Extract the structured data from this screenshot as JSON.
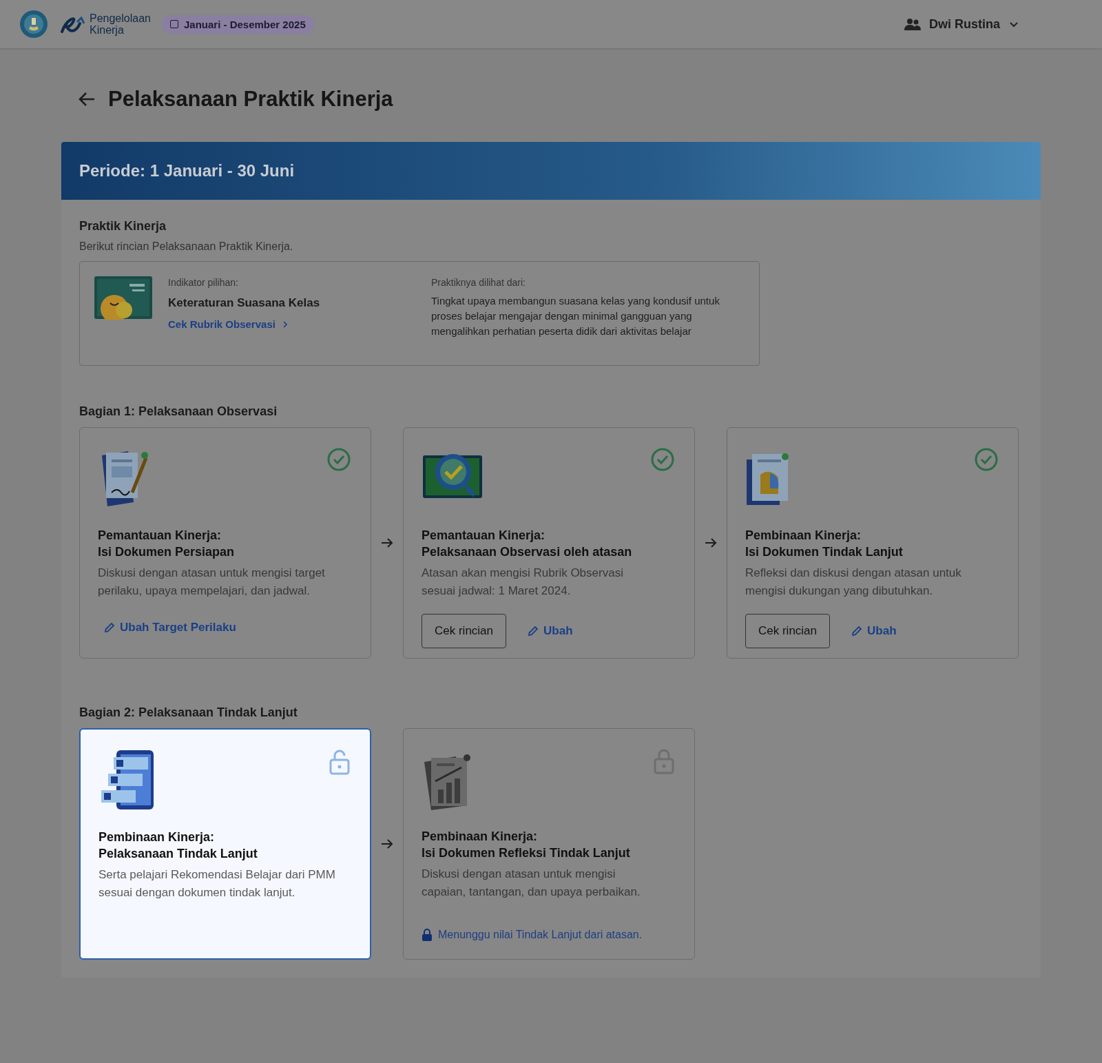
{
  "header": {
    "logo_text": [
      "Pengelolaan",
      "Kinerja"
    ],
    "period_badge": "Januari - Desember 2025",
    "user": "Dwi Rustina"
  },
  "page_title": "Pelaksanaan Praktik Kinerja",
  "period_banner": "Periode: 1 Januari - 30 Juni",
  "practice": {
    "title": "Praktik Kinerja",
    "subtitle": "Berikut rincian Pelaksanaan Praktik Kinerja.",
    "indicator_label": "Indikator pilihan:",
    "indicator_value": "Keteraturan Suasana Kelas",
    "rubric_link": "Cek Rubrik Observasi",
    "seen_label": "Praktiknya dilihat dari:",
    "seen_text": "Tingkat upaya membangun suasana kelas yang kondusif untuk proses belajar mengajar dengan minimal gangguan yang mengalihkan perhatian peserta didik dari aktivitas belajar"
  },
  "sections": [
    {
      "title": "Bagian 1: Pelaksanaan Observasi",
      "cards": [
        {
          "completed": true,
          "highlighted": false,
          "title": [
            "Pemantauan Kinerja:",
            "Isi Dokumen Persiapan"
          ],
          "description": "Diskusi dengan atasan untuk mengisi target perilaku, upaya mempelajari, dan jadwal.",
          "actions": [
            {
              "kind": "edit",
              "label": "Ubah Target Perilaku"
            }
          ]
        },
        {
          "completed": true,
          "highlighted": false,
          "title": [
            "Pemantauan Kinerja:",
            "Pelaksanaan Observasi oleh atasan"
          ],
          "description": "Atasan akan mengisi Rubrik Observasi sesuai jadwal: 1 Maret 2024.",
          "actions": [
            {
              "kind": "button",
              "label": "Cek rincian"
            },
            {
              "kind": "edit",
              "label": "Ubah"
            }
          ]
        },
        {
          "completed": true,
          "highlighted": false,
          "title": [
            "Pembinaan Kinerja:",
            "Isi Dokumen Tindak Lanjut"
          ],
          "description": "Refleksi dan diskusi dengan atasan untuk mengisi dukungan yang dibutuhkan.",
          "actions": [
            {
              "kind": "button",
              "label": "Cek rincian"
            },
            {
              "kind": "edit",
              "label": "Ubah"
            }
          ]
        }
      ]
    },
    {
      "title": "Bagian 2: Pelaksanaan Tindak Lanjut",
      "cards": [
        {
          "completed": false,
          "locked": false,
          "highlighted": true,
          "title": [
            "Pembinaan Kinerja:",
            "Pelaksanaan Tindak Lanjut"
          ],
          "description": "Serta pelajari Rekomendasi Belajar dari PMM sesuai dengan dokumen tindak lanjut."
        },
        {
          "completed": false,
          "locked": true,
          "highlighted": false,
          "title": [
            "Pembinaan Kinerja:",
            "Isi Dokumen Refleksi Tindak Lanjut"
          ],
          "description": "Diskusi dengan atasan untuk mengisi capaian, tantangan, dan upaya perbaikan.",
          "actions": [
            {
              "kind": "locked-note",
              "label": "Menunggu nilai Tindak Lanjut dari atasan."
            }
          ]
        }
      ]
    }
  ]
}
